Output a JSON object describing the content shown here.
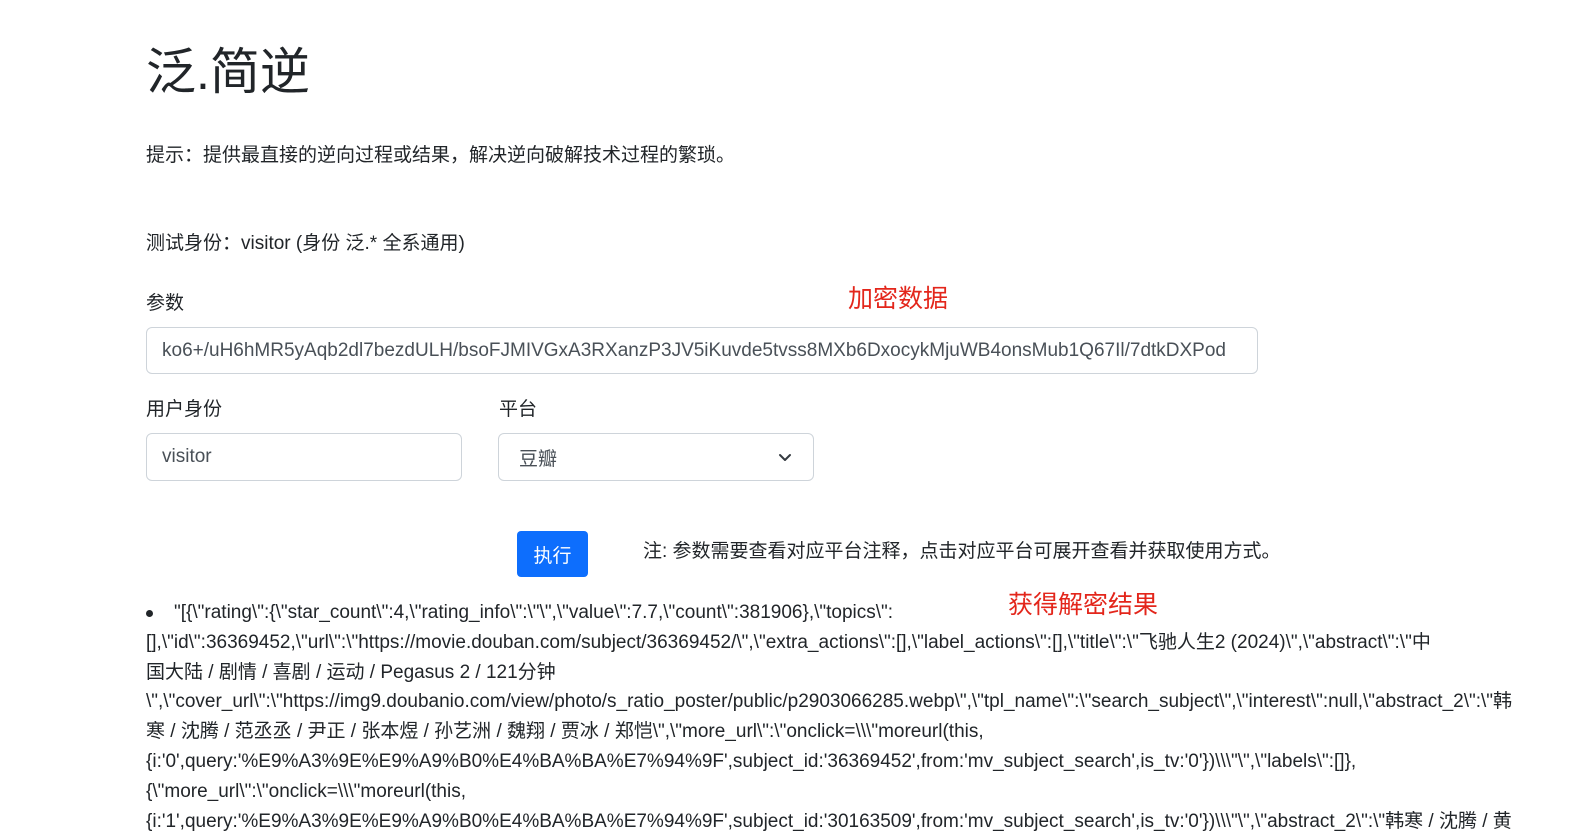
{
  "page": {
    "title": "泛.简逆",
    "hint": "提示：提供最直接的逆向过程或结果，解决逆向破解技术过程的繁琐。",
    "test_identity": "测试身份：visitor (身份 泛.* 全系通用)"
  },
  "form": {
    "param_label": "参数",
    "param_value": "ko6+/uH6hMR5yAqb2dl7bezdULH/bsoFJMIVGxA3RXanzP3JV5iKuvde5tvss8MXb6DxocykMjuWB4onsMub1Q67Il/7dtkDXPod",
    "user_label": "用户身份",
    "user_value": "visitor",
    "platform_label": "平台",
    "platform_selected": "豆瓣",
    "execute_label": "执行",
    "note": "注: 参数需要查看对应平台注释，点击对应平台可展开查看并获取使用方式。"
  },
  "annotations": {
    "encrypted_data": "加密数据",
    "decrypted_result": "获得解密结果"
  },
  "result": {
    "lines": [
      "\"[{\\\"rating\\\":{\\\"star_count\\\":4,\\\"rating_info\\\":\\\"\\\",\\\"value\\\":7.7,\\\"count\\\":381906},\\\"topics\\\":",
      "[],\\\"id\\\":36369452,\\\"url\\\":\\\"https://movie.douban.com/subject/36369452/\\\",\\\"extra_actions\\\":[],\\\"label_actions\\\":[],\\\"title\\\":\\\"飞驰人生2 (2024)\\\",\\\"abstract\\\":\\\"中",
      "国大陆 / 剧情 / 喜剧 / 运动 / Pegasus 2 / 121分钟",
      "\\\",\\\"cover_url\\\":\\\"https://img9.doubanio.com/view/photo/s_ratio_poster/public/p2903066285.webp\\\",\\\"tpl_name\\\":\\\"search_subject\\\",\\\"interest\\\":null,\\\"abstract_2\\\":\\\"韩",
      "寒 / 沈腾 / 范丞丞 / 尹正 / 张本煜 / 孙艺洲 / 魏翔 / 贾冰 / 郑恺\\\",\\\"more_url\\\":\\\"onclick=\\\\\\\"moreurl(this,",
      "{i:'0',query:'%E9%A3%9E%E9%A9%B0%E4%BA%BA%E7%94%9F',subject_id:'36369452',from:'mv_subject_search',is_tv:'0'})\\\\\\\"\\\",\\\"labels\\\":[]},",
      "{\\\"more_url\\\":\\\"onclick=\\\\\\\"moreurl(this,",
      "{i:'1',query:'%E9%A3%9E%E9%A9%B0%E4%BA%BA%E7%94%9F',subject_id:'30163509',from:'mv_subject_search',is_tv:'0'})\\\\\\\"\\\",\\\"abstract_2\\\":\\\"韩寒 / 沈腾 / 黄"
    ]
  },
  "icons": {
    "select_arrow": "chevron-down-icon",
    "bullet": "bullet-dot"
  },
  "colors": {
    "primary": "#0d6efd",
    "annotation": "#e3261b",
    "text": "#212529",
    "border": "#ced4da"
  }
}
